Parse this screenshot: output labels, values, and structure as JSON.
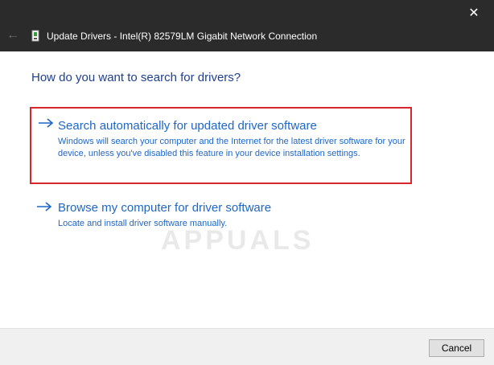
{
  "window": {
    "title": "Update Drivers - Intel(R) 82579LM Gigabit Network Connection",
    "close_glyph": "✕",
    "back_glyph": "←"
  },
  "main": {
    "question": "How do you want to search for drivers?",
    "options": [
      {
        "title": "Search automatically for updated driver software",
        "description": "Windows will search your computer and the Internet for the latest driver software for your device, unless you've disabled this feature in your device installation settings."
      },
      {
        "title": "Browse my computer for driver software",
        "description": "Locate and install driver software manually."
      }
    ]
  },
  "watermark": "APPUALS",
  "footer": {
    "cancel_label": "Cancel"
  },
  "colors": {
    "titlebar": "#2b2b2b",
    "link": "#1e66c9",
    "heading": "#1f3f8f",
    "highlight_border": "#d9262a"
  },
  "icons": [
    "close-icon",
    "back-arrow-icon",
    "network-adapter-icon",
    "arrow-right-icon"
  ]
}
